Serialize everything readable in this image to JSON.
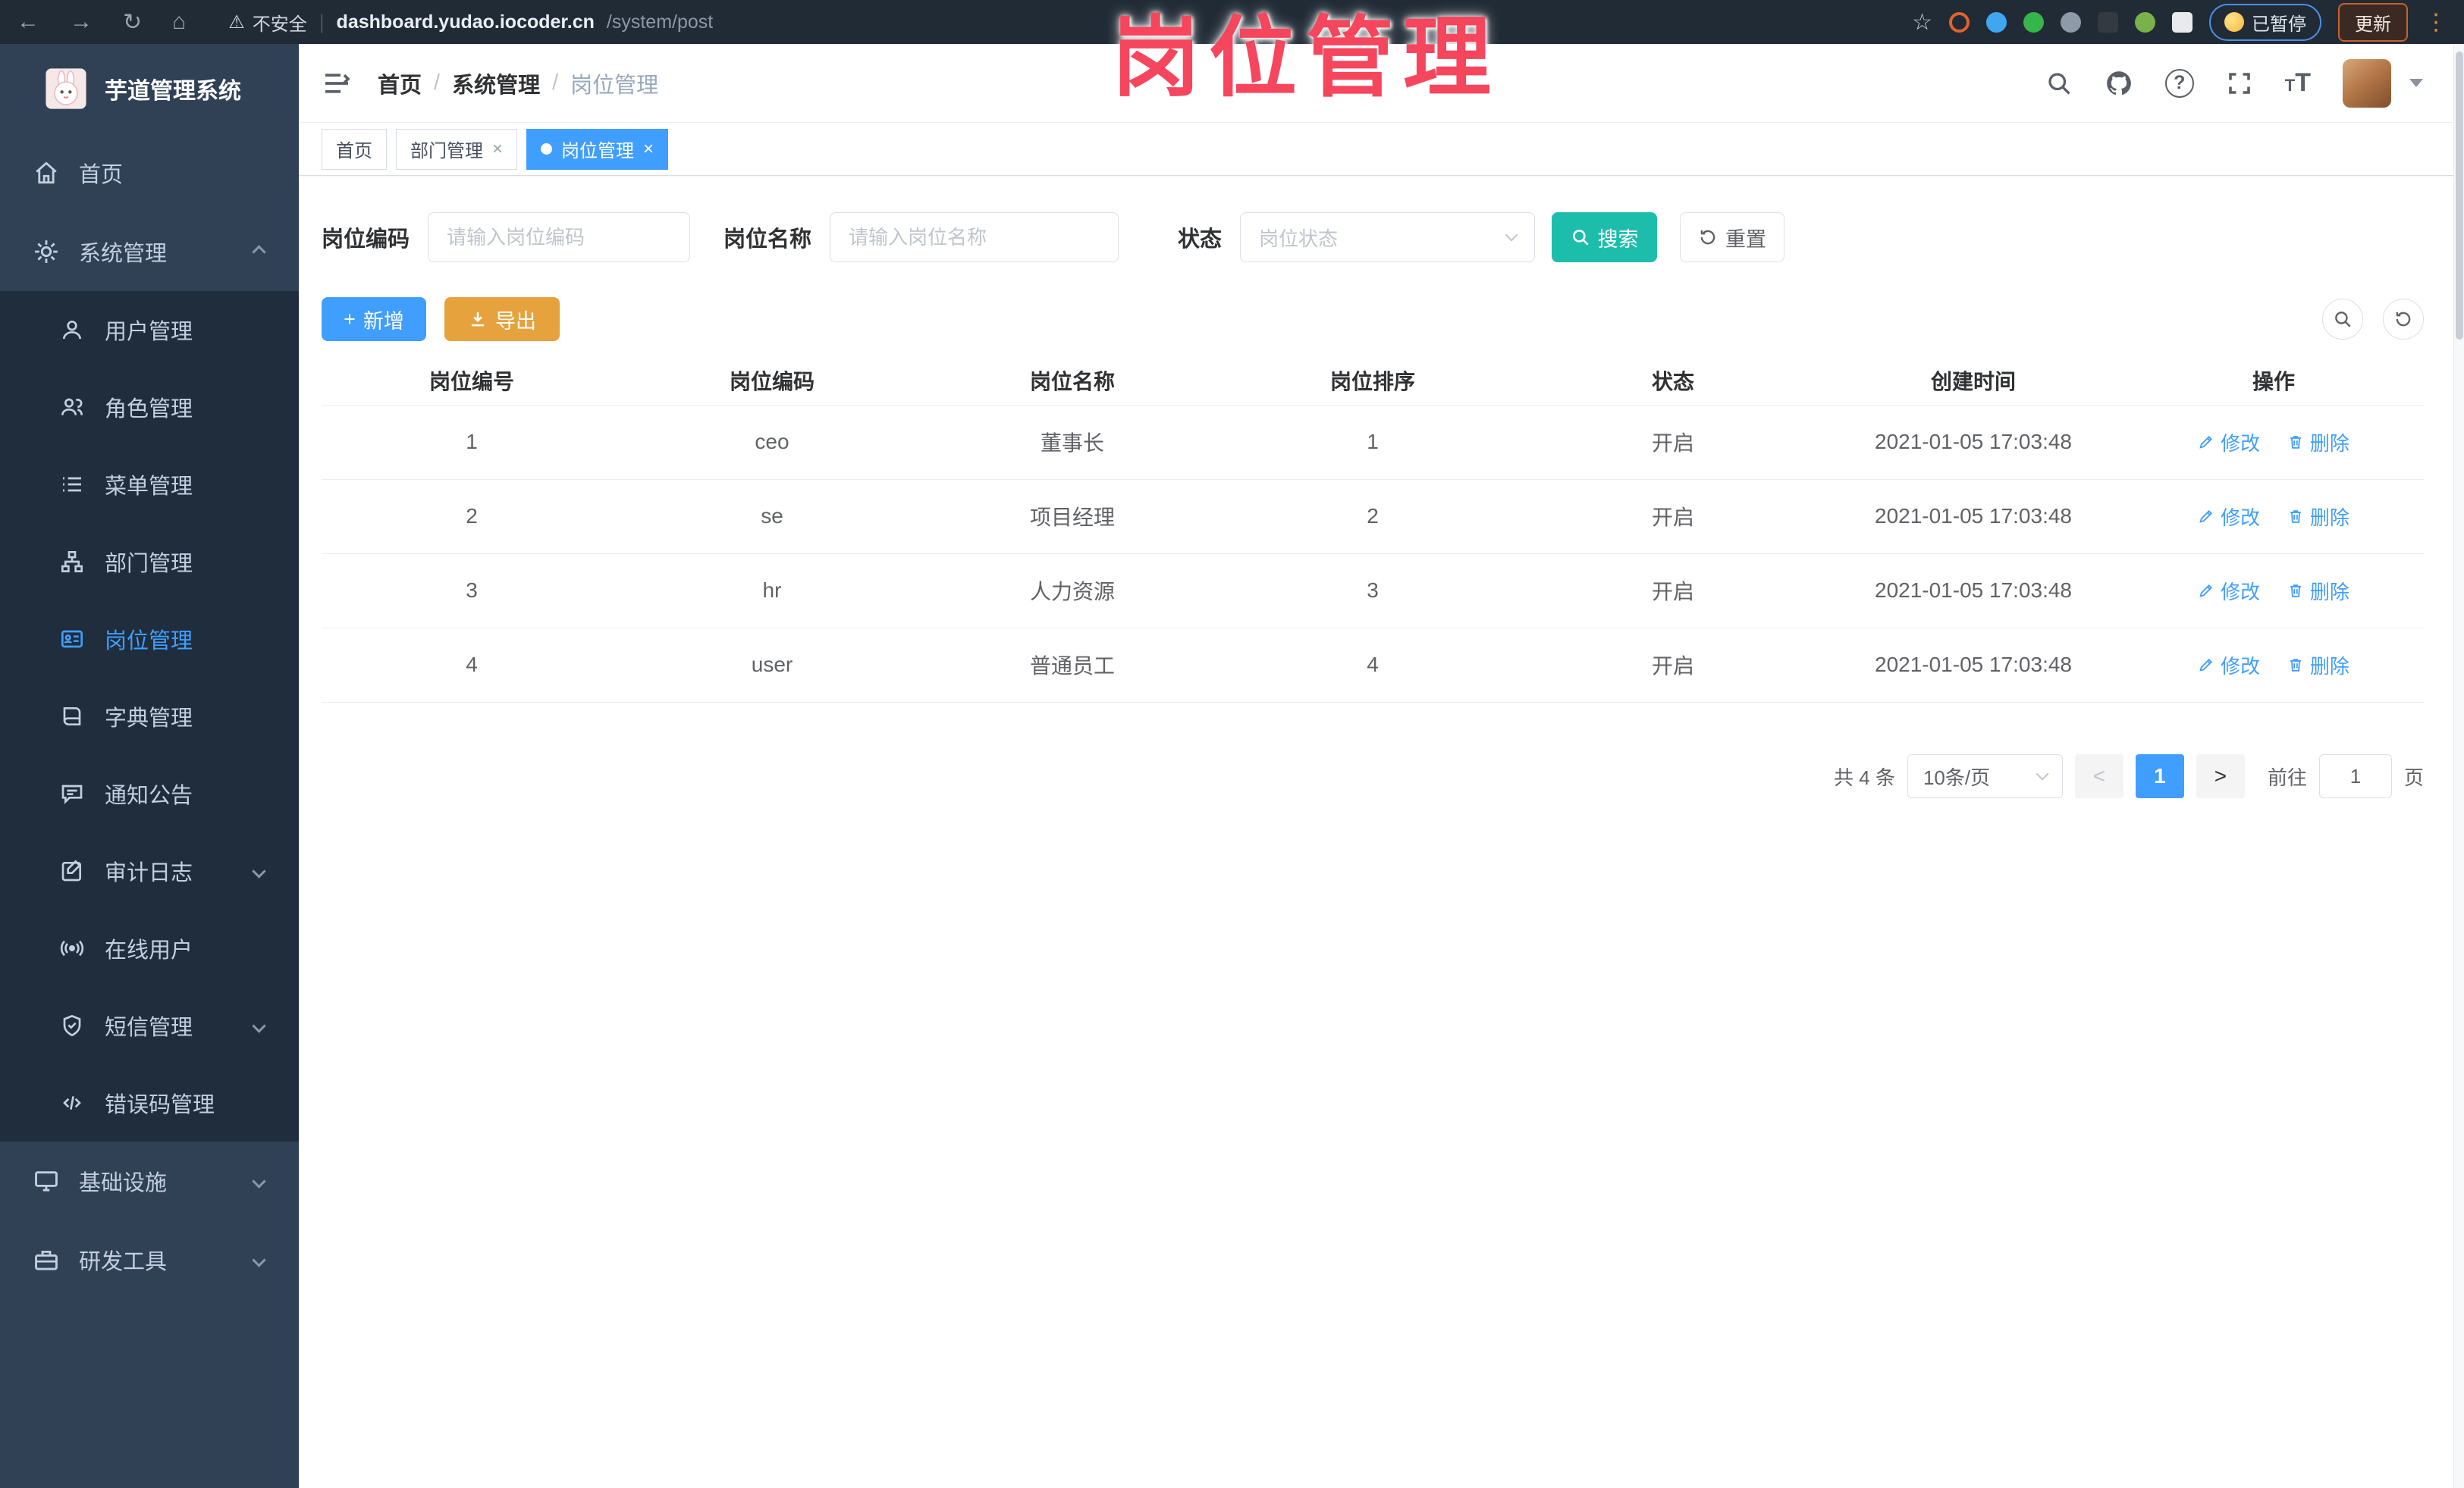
{
  "colors": {
    "accent": "#409eff",
    "warning": "#e6a23c",
    "teal": "#1dbdac",
    "overlay": "#f5465d",
    "sidebar_bg": "#304156",
    "submenu_bg": "#1f2d3d",
    "browser_bg": "#212b36"
  },
  "overlay_title": "岗位管理",
  "glyphs": {
    "back": "←",
    "forward": "→",
    "reload": "↻",
    "home": "⌂",
    "warning": "⚠",
    "star": "☆",
    "menu_dots": "⋮",
    "close": "×",
    "prev": "<",
    "next": ">",
    "plus": "+",
    "question": "?",
    "tt_small": "T",
    "tt_big": "T",
    "sep_pipe": "|"
  },
  "browser": {
    "security_label": "不安全",
    "url_host": "dashboard.yudao.iocoder.cn",
    "url_path": "/system/post",
    "paused_label": "已暂停",
    "update_label": "更新"
  },
  "sidebar": {
    "app_title": "芋道管理系统",
    "home_label": "首页",
    "system_label": "系统管理",
    "infra_label": "基础设施",
    "devtools_label": "研发工具",
    "submenu": [
      "用户管理",
      "角色管理",
      "菜单管理",
      "部门管理",
      "岗位管理",
      "字典管理",
      "通知公告",
      "审计日志",
      "在线用户",
      "短信管理",
      "错误码管理"
    ]
  },
  "breadcrumb": {
    "separator": "/",
    "items": [
      "首页",
      "系统管理",
      "岗位管理"
    ]
  },
  "tabs": [
    {
      "label": "首页"
    },
    {
      "label": "部门管理"
    },
    {
      "label": "岗位管理"
    }
  ],
  "filters": {
    "code_label": "岗位编码",
    "code_placeholder": "请输入岗位编码",
    "name_label": "岗位名称",
    "name_placeholder": "请输入岗位名称",
    "status_label": "状态",
    "status_placeholder": "岗位状态",
    "search_label": "搜索",
    "reset_label": "重置"
  },
  "toolbar": {
    "add_label": "新增",
    "export_label": "导出"
  },
  "table": {
    "headers": [
      "岗位编号",
      "岗位编码",
      "岗位名称",
      "岗位排序",
      "状态",
      "创建时间",
      "操作"
    ],
    "rows": [
      {
        "id": "1",
        "code": "ceo",
        "name": "董事长",
        "sort": "1",
        "status": "开启",
        "time": "2021-01-05 17:03:48"
      },
      {
        "id": "2",
        "code": "se",
        "name": "项目经理",
        "sort": "2",
        "status": "开启",
        "time": "2021-01-05 17:03:48"
      },
      {
        "id": "3",
        "code": "hr",
        "name": "人力资源",
        "sort": "3",
        "status": "开启",
        "time": "2021-01-05 17:03:48"
      },
      {
        "id": "4",
        "code": "user",
        "name": "普通员工",
        "sort": "4",
        "status": "开启",
        "time": "2021-01-05 17:03:48"
      }
    ],
    "edit_label": "修改",
    "delete_label": "删除"
  },
  "pagination": {
    "total_text": "共 4 条",
    "page_size": "10条/页",
    "current_page": "1",
    "goto_label": "前往",
    "goto_value": "1",
    "page_suffix": "页"
  }
}
